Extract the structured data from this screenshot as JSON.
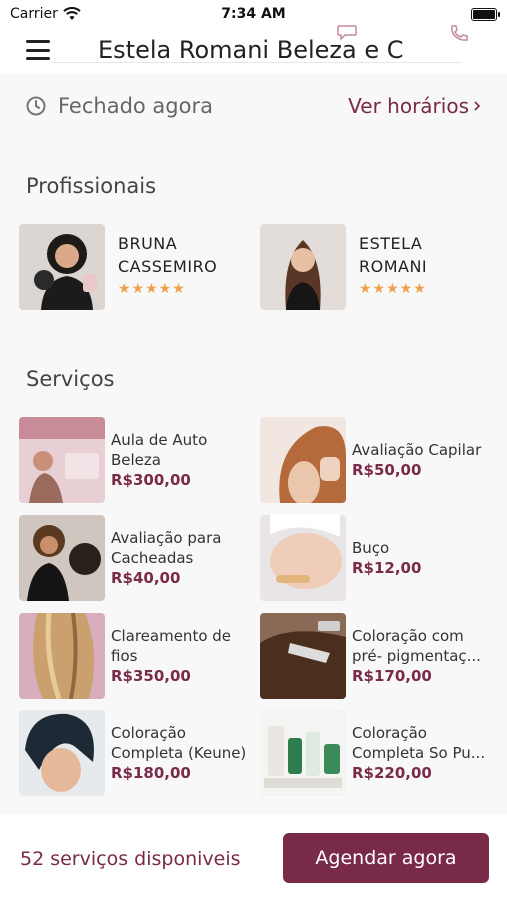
{
  "status_bar": {
    "carrier": "Carrier",
    "time": "7:34 AM"
  },
  "header": {
    "title": "Estela Romani Beleza e C"
  },
  "hours": {
    "status": "Fechado agora",
    "link": "Ver horários"
  },
  "sections": {
    "professionals": "Profissionais",
    "services": "Serviços"
  },
  "professionals": [
    {
      "name": "BRUNA CASSEMIRO",
      "rating": 5
    },
    {
      "name": "ESTELA ROMANI",
      "rating": 5
    }
  ],
  "services": [
    {
      "name": "Aula de Auto Beleza",
      "price": "R$300,00"
    },
    {
      "name": "Avaliação Capilar",
      "price": "R$50,00"
    },
    {
      "name": "Avaliação para Cacheadas",
      "price": "R$40,00"
    },
    {
      "name": "Buço",
      "price": "R$12,00"
    },
    {
      "name": "Clareamento de fios",
      "price": "R$350,00"
    },
    {
      "name": "Coloração com pré- pigmentaç...",
      "price": "R$170,00"
    },
    {
      "name": "Coloração Completa (Keune)",
      "price": "R$180,00"
    },
    {
      "name": "Coloração Completa So Pu...",
      "price": "R$220,00"
    }
  ],
  "footer": {
    "available": "52 serviços disponiveis",
    "cta": "Agendar agora"
  },
  "colors": {
    "accent": "#7a2a49",
    "star": "#f0a04b"
  },
  "icons": {
    "clock": "clock-icon",
    "menu": "hamburger-menu-icon",
    "chevron": "chevron-right-icon",
    "chat": "chat-icon",
    "phone": "phone-icon"
  }
}
